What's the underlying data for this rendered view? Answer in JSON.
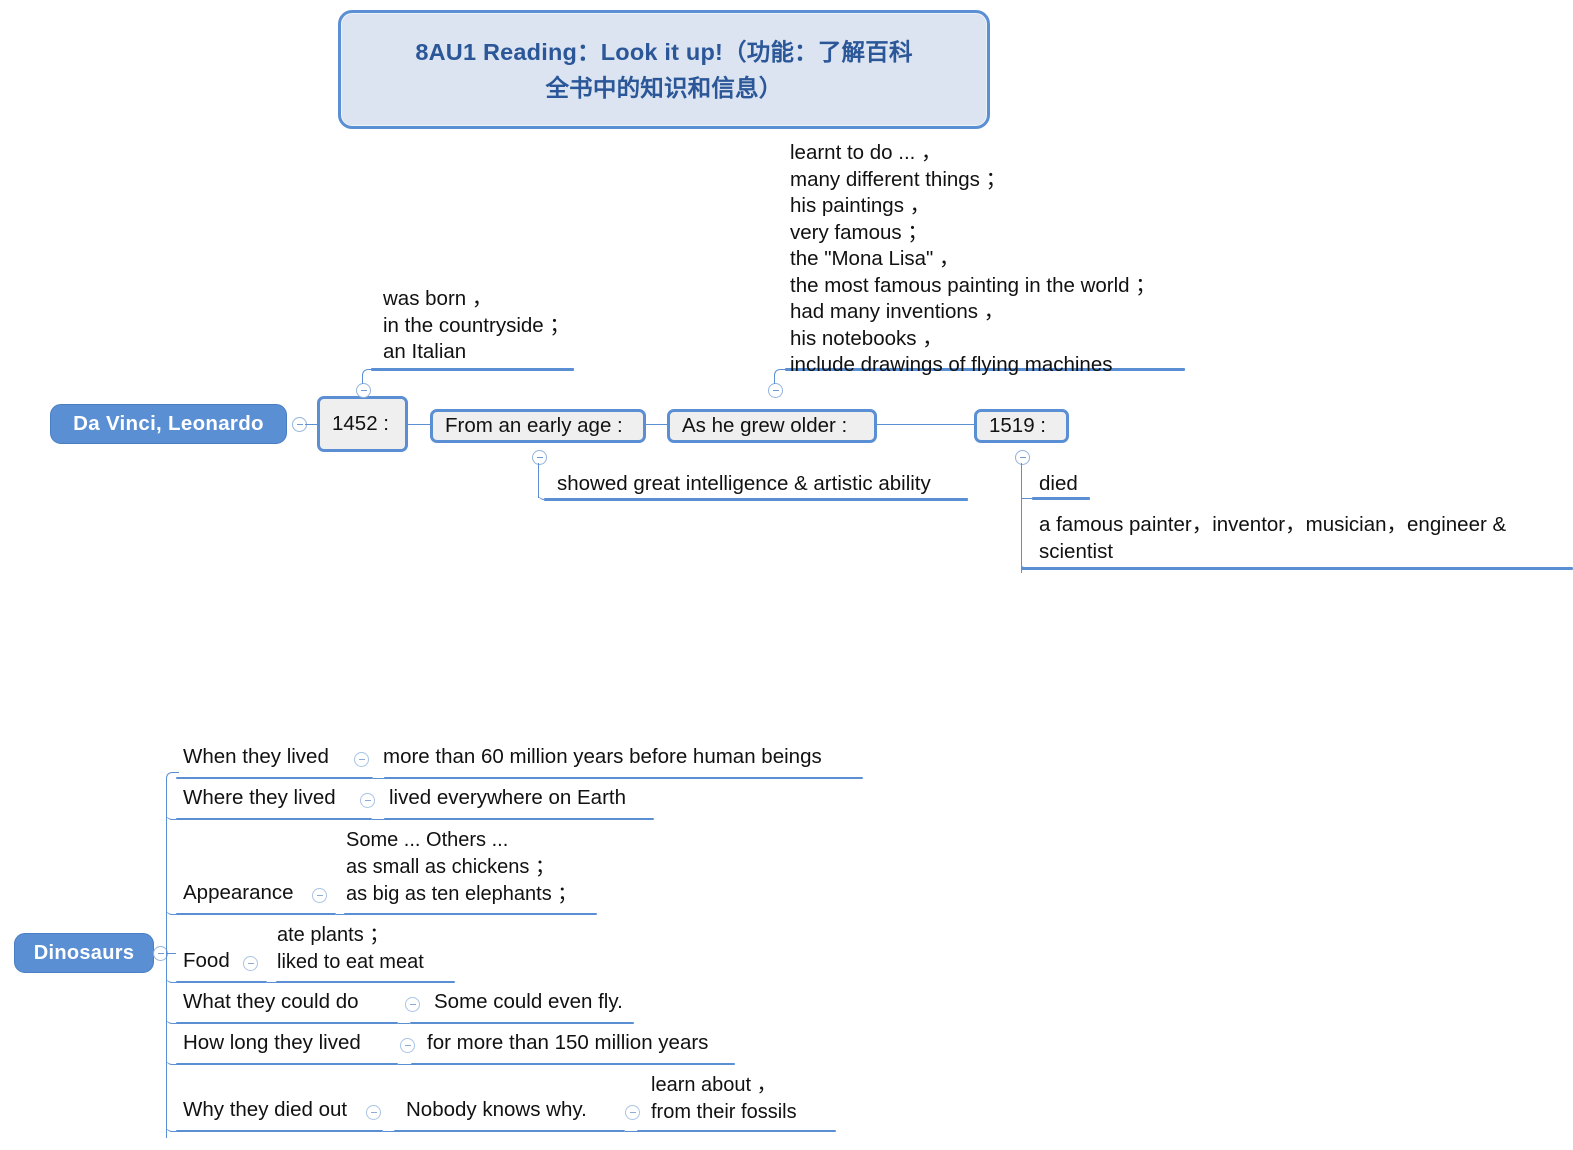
{
  "title": {
    "line1": "8AU1 Reading：Look it up!（功能：了解百科",
    "line2": "全书中的知识和信息）"
  },
  "davinci": {
    "root_label": "Da Vinci, Leonardo",
    "stages": [
      {
        "label": "1452 :"
      },
      {
        "label": "From an early age :"
      },
      {
        "label": "As he grew older :"
      },
      {
        "label": "1519 :"
      }
    ],
    "notes": {
      "born": "was born ，\nin the countryside ；\nan Italian",
      "older": "learnt to do ... ，\nmany different things ；\nhis paintings ，\nvery famous ；\nthe \"Mona Lisa\" ，\nthe most famous painting in the world ；\nhad many inventions ，\nhis notebooks ，\ninclude drawings of flying machines",
      "early_age": "showed great intelligence & artistic ability",
      "died": "died",
      "titles": "a famous painter，inventor，musician，engineer &\nscientist"
    }
  },
  "dinosaurs": {
    "root_label": "Dinosaurs",
    "rows": [
      {
        "label": "When they lived",
        "value": "more than 60 million years before human beings"
      },
      {
        "label": "Where they lived",
        "value": "lived everywhere on Earth"
      },
      {
        "label": "Appearance",
        "value": "Some ... Others ...\nas small as chickens ；\nas big as ten elephants ；"
      },
      {
        "label": "Food",
        "value": "ate plants ；\nliked to eat meat"
      },
      {
        "label": "What they could do",
        "value": "Some could even fly."
      },
      {
        "label": "How long they lived",
        "value": "for more than 150 million years"
      },
      {
        "label": "Why they died out",
        "value": "Nobody knows why.",
        "value2": "learn about ，\nfrom their fossils"
      }
    ]
  },
  "icons": {
    "collapse": "collapse-toggle"
  },
  "colors": {
    "accent_blue": "#5b8fd4",
    "title_fill": "#dbe4f0",
    "title_text": "#2b5799",
    "box_fill": "#efefef",
    "text": "#111111"
  }
}
